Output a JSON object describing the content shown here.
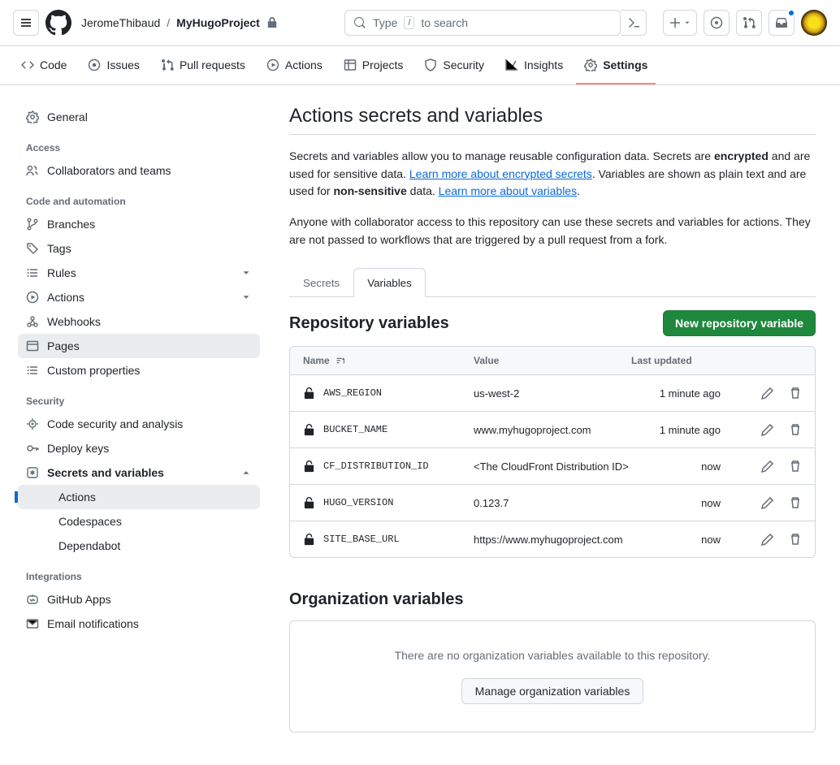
{
  "header": {
    "owner": "JeromeThibaud",
    "repo": "MyHugoProject",
    "search_prefix": "Type",
    "search_kbd": "/",
    "search_suffix": "to search"
  },
  "repoNav": {
    "code": "Code",
    "issues": "Issues",
    "pulls": "Pull requests",
    "actions": "Actions",
    "projects": "Projects",
    "security": "Security",
    "insights": "Insights",
    "settings": "Settings"
  },
  "sidebar": {
    "general": "General",
    "accessHeading": "Access",
    "collaborators": "Collaborators and teams",
    "codeHeading": "Code and automation",
    "branches": "Branches",
    "tags": "Tags",
    "rules": "Rules",
    "actions": "Actions",
    "webhooks": "Webhooks",
    "pages": "Pages",
    "customProps": "Custom properties",
    "securityHeading": "Security",
    "codeSecurity": "Code security and analysis",
    "deployKeys": "Deploy keys",
    "secretsVars": "Secrets and variables",
    "secretsActions": "Actions",
    "secretsCodespaces": "Codespaces",
    "secretsDependabot": "Dependabot",
    "integrationsHeading": "Integrations",
    "githubApps": "GitHub Apps",
    "emailNotifs": "Email notifications"
  },
  "page": {
    "title": "Actions secrets and variables",
    "intro1a": "Secrets and variables allow you to manage reusable configuration data. Secrets are ",
    "intro1b": "encrypted",
    "intro1c": " and are used for sensitive data. ",
    "intro1link1": "Learn more about encrypted secrets",
    "intro1d": ". Variables are shown as plain text and are used for ",
    "intro1e": "non-sensitive",
    "intro1f": " data. ",
    "intro1link2": "Learn more about variables",
    "intro1g": ".",
    "intro2": "Anyone with collaborator access to this repository can use these secrets and variables for actions. They are not passed to workflows that are triggered by a pull request from a fork."
  },
  "tabs": {
    "secrets": "Secrets",
    "variables": "Variables"
  },
  "repoVars": {
    "heading": "Repository variables",
    "newBtn": "New repository variable",
    "colName": "Name",
    "colValue": "Value",
    "colUpdated": "Last updated",
    "rows": [
      {
        "name": "AWS_REGION",
        "value": "us-west-2",
        "updated": "1 minute ago"
      },
      {
        "name": "BUCKET_NAME",
        "value": "www.myhugoproject.com",
        "updated": "1 minute ago"
      },
      {
        "name": "CF_DISTRIBUTION_ID",
        "value": "<The CloudFront Distribution ID>",
        "updated": "now"
      },
      {
        "name": "HUGO_VERSION",
        "value": "0.123.7",
        "updated": "now"
      },
      {
        "name": "SITE_BASE_URL",
        "value": "https://www.myhugoproject.com",
        "updated": "now"
      }
    ]
  },
  "orgVars": {
    "heading": "Organization variables",
    "empty": "There are no organization variables available to this repository.",
    "manageBtn": "Manage organization variables"
  }
}
